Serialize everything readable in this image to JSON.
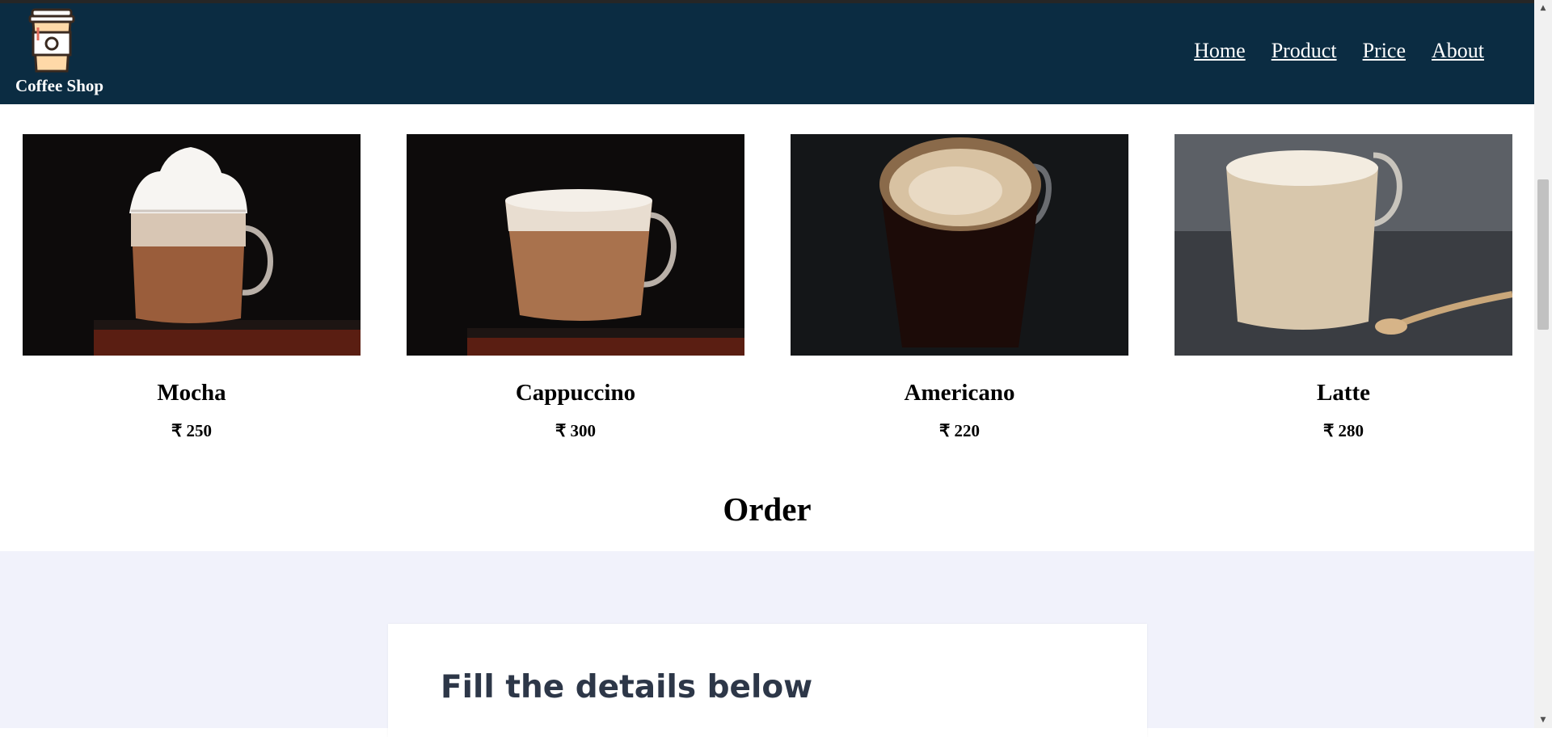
{
  "header": {
    "brand": "Coffee Shop",
    "logo_icon": "coffee-cup-icon",
    "nav": [
      "Home",
      "Product",
      "Price",
      "About"
    ]
  },
  "products": [
    {
      "name": "Mocha",
      "price": "₹ 250",
      "image": "mocha-glass-image"
    },
    {
      "name": "Cappuccino",
      "price": "₹ 300",
      "image": "cappuccino-glass-image"
    },
    {
      "name": "Americano",
      "price": "₹ 220",
      "image": "americano-glass-image"
    },
    {
      "name": "Latte",
      "price": "₹ 280",
      "image": "latte-glass-image"
    }
  ],
  "order": {
    "heading": "Order",
    "form_title": "Fill the details below"
  },
  "colors": {
    "navbar": "#0b2c42",
    "form_background": "#f1f2fb",
    "form_title": "#2d3748"
  }
}
